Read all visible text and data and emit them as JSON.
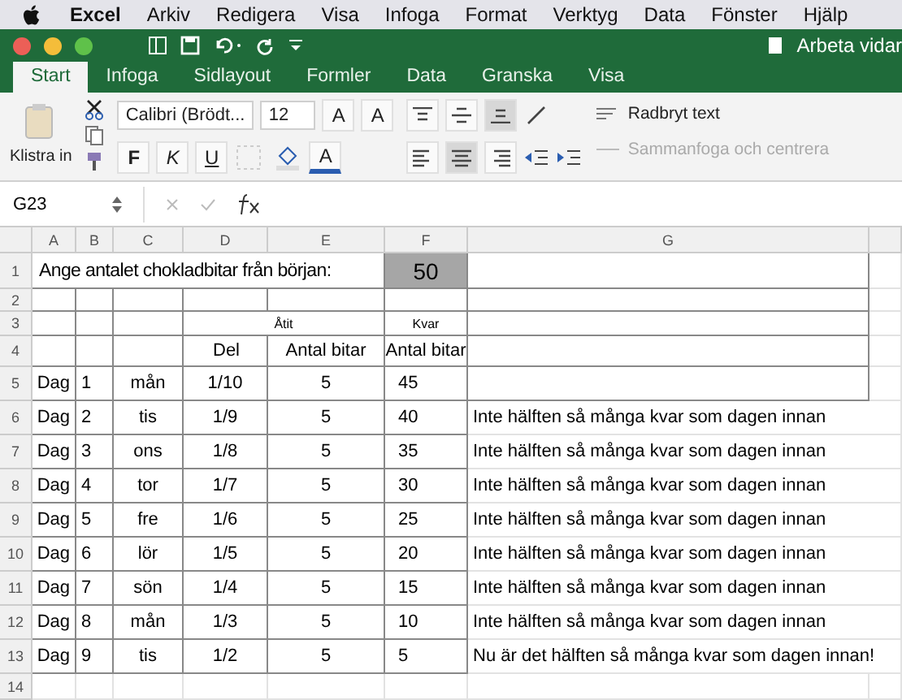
{
  "menubar": {
    "app": "Excel",
    "items": [
      "Arkiv",
      "Redigera",
      "Visa",
      "Infoga",
      "Format",
      "Verktyg",
      "Data",
      "Fönster",
      "Hjälp"
    ]
  },
  "window": {
    "title": "Arbeta vidar"
  },
  "tabs": [
    {
      "label": "Start",
      "selected": true
    },
    {
      "label": "Infoga",
      "selected": false
    },
    {
      "label": "Sidlayout",
      "selected": false
    },
    {
      "label": "Formler",
      "selected": false
    },
    {
      "label": "Data",
      "selected": false
    },
    {
      "label": "Granska",
      "selected": false
    },
    {
      "label": "Visa",
      "selected": false
    }
  ],
  "ribbon": {
    "paste_label": "Klistra in",
    "font_name": "Calibri (Brödt...",
    "font_size": "12",
    "grow_label": "A",
    "shrink_label": "A",
    "bold_label": "F",
    "italic_label": "K",
    "underline_label": "U",
    "font_color_label": "A",
    "vertical_align": [
      {
        "kind": "top",
        "selected": false
      },
      {
        "kind": "middle",
        "selected": false
      },
      {
        "kind": "bottom",
        "selected": true
      }
    ],
    "horizontal_align": [
      {
        "kind": "left",
        "selected": false
      },
      {
        "kind": "center",
        "selected": true
      },
      {
        "kind": "right",
        "selected": false
      }
    ],
    "wrap_text": {
      "label": "Radbryt text",
      "disabled": false
    },
    "merge": {
      "label": "Sammanfoga och centrera",
      "disabled": true
    }
  },
  "formula_bar": {
    "cell_ref": "G23"
  },
  "sheet": {
    "columns": [
      "A",
      "B",
      "C",
      "D",
      "E",
      "F",
      "G"
    ],
    "row_numbers": [
      "1",
      "2",
      "3",
      "4",
      "5",
      "6",
      "7",
      "8",
      "9",
      "10",
      "11",
      "12",
      "13",
      "14"
    ],
    "prompt": "Ange antalet chokladbitar från början:",
    "start_value": "50",
    "eaten_header": "Åtit",
    "left_header": "Kvar",
    "subheaders": [
      "Del",
      "Antal bitar",
      "Antal bitar"
    ],
    "rows": [
      {
        "cells": [
          "Dag",
          "1",
          "mån",
          "1/10",
          "5",
          "45",
          ""
        ]
      },
      {
        "cells": [
          "Dag",
          "2",
          "tis",
          "1/9",
          "5",
          "40",
          "Inte hälften så många kvar som dagen innan"
        ]
      },
      {
        "cells": [
          "Dag",
          "3",
          "ons",
          "1/8",
          "5",
          "35",
          "Inte hälften så många kvar som dagen innan"
        ]
      },
      {
        "cells": [
          "Dag",
          "4",
          "tor",
          "1/7",
          "5",
          "30",
          "Inte hälften så många kvar som dagen innan"
        ]
      },
      {
        "cells": [
          "Dag",
          "5",
          "fre",
          "1/6",
          "5",
          "25",
          "Inte hälften så många kvar som dagen innan"
        ]
      },
      {
        "cells": [
          "Dag",
          "6",
          "lör",
          "1/5",
          "5",
          "20",
          "Inte hälften så många kvar som dagen innan"
        ]
      },
      {
        "cells": [
          "Dag",
          "7",
          "sön",
          "1/4",
          "5",
          "15",
          "Inte hälften så många kvar som dagen innan"
        ]
      },
      {
        "cells": [
          "Dag",
          "8",
          "mån",
          "1/3",
          "5",
          "10",
          "Inte hälften så många kvar som dagen innan"
        ]
      },
      {
        "cells": [
          "Dag",
          "9",
          "tis",
          "1/2",
          "5",
          "5",
          "Nu är det hälften så många kvar som dagen innan!"
        ]
      }
    ]
  }
}
